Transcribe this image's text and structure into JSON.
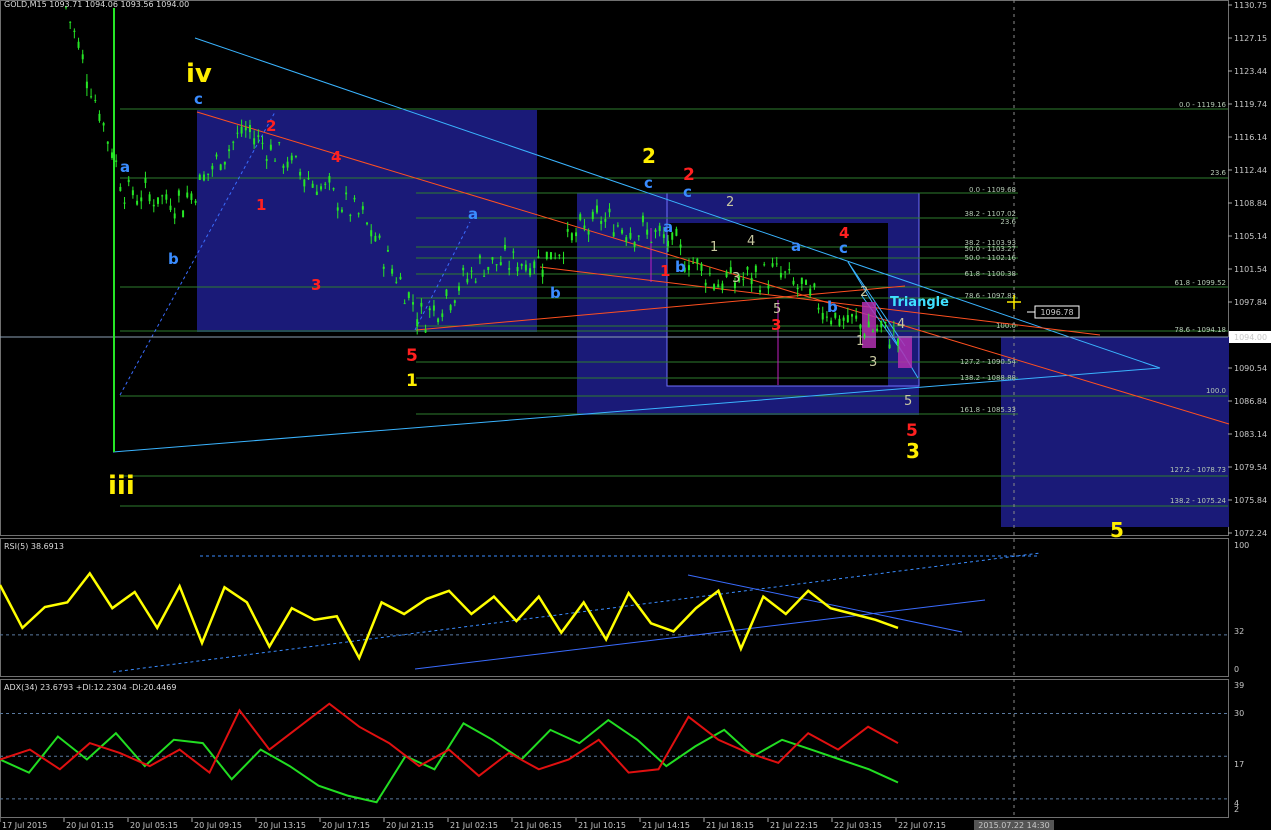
{
  "main_header": "GOLD,M15  1093.71 1094.06 1093.56 1094.00",
  "rsi_header": "RSI(5) 38.6913",
  "adx_header": "ADX(34) 23.6793  +DI:12.2304  -DI:20.4469",
  "price_ticks": [
    "1130.75",
    "1127.15",
    "1123.44",
    "1119.74",
    "1116.14",
    "1112.44",
    "1108.84",
    "1105.14",
    "1101.54",
    "1097.84",
    "1094.00",
    "1090.54",
    "1086.84",
    "1083.14",
    "1079.54",
    "1075.84",
    "1072.24"
  ],
  "current_price": "1094.00",
  "cursor_price": "1096.78",
  "rsi_ticks": [
    "100",
    "32",
    "0"
  ],
  "adx_ticks": [
    "39",
    "30",
    "17",
    "4",
    "2"
  ],
  "time_ticks": [
    "17 Jul 2015",
    "20 Jul 01:15",
    "20 Jul 05:15",
    "20 Jul 09:15",
    "20 Jul 13:15",
    "20 Jul 17:15",
    "20 Jul 21:15",
    "21 Jul 02:15",
    "21 Jul 06:15",
    "21 Jul 10:15",
    "21 Jul 14:15",
    "21 Jul 18:15",
    "21 Jul 22:15",
    "22 Jul 03:15",
    "22 Jul 07:15"
  ],
  "time_cursor": "2015.07.22 14:30",
  "fib_levels_a": [
    "0.0 - 1119.16",
    "23.6",
    "61.8 - 1099.52",
    "78.6 - 1094.18",
    "100.0",
    "127.2 - 1078.73",
    "138.2 - 1075.24"
  ],
  "fib_levels_b": [
    "0.0 - 1109.68",
    "38.2 - 1107.02",
    "23.6",
    "38.2 - 1103.93",
    "50.0 - 1103.27",
    "50.0 - 1102.16",
    "61.8 - 1100.38",
    "78.6 - 1097.83",
    "100.0",
    "127.2 - 1090.54",
    "138.2 - 1088.88",
    "161.8 - 1085.33"
  ],
  "wave_labels": {
    "iv": "iv",
    "iii": "iii",
    "triangle": "Triangle",
    "a": "a",
    "b": "b",
    "c": "c",
    "n1": "1",
    "n2": "2",
    "n3": "3",
    "n4": "4",
    "n5": "5"
  },
  "colors": {
    "background": "#000000",
    "candle": "#26e626",
    "rsi": "#ffff00",
    "plus_di": "#22dd22",
    "minus_di": "#e01010",
    "box": "#1a1a78",
    "trendline": "#3ab4ff",
    "orange": "#ff5020",
    "fib": "#2e7d2e",
    "wave_yellow": "#ffee00",
    "wave_red": "#ff2020",
    "wave_blue": "#3a8cff",
    "wave_grey": "#c8c8a0"
  },
  "chart_data": [
    {
      "type": "candlestick",
      "title": "GOLD,M15",
      "ylim": [
        1072.24,
        1130.75
      ],
      "x": [
        "17 Jul 2015",
        "20 Jul 01:15",
        "20 Jul 05:15",
        "20 Jul 09:15",
        "20 Jul 13:15",
        "20 Jul 17:15",
        "20 Jul 21:15",
        "21 Jul 02:15",
        "21 Jul 06:15",
        "21 Jul 10:15",
        "21 Jul 14:15",
        "21 Jul 18:15",
        "21 Jul 22:15",
        "22 Jul 03:15",
        "22 Jul 07:15"
      ],
      "close_approx": [
        1130.5,
        1110.0,
        1109.0,
        1117.0,
        1112.0,
        1107.0,
        1096.0,
        1102.0,
        1102.5,
        1107.0,
        1105.0,
        1100.0,
        1101.0,
        1096.0,
        1094.0
      ],
      "last_ohlc": {
        "open": 1093.71,
        "high": 1094.06,
        "low": 1093.56,
        "close": 1094.0
      }
    },
    {
      "type": "line",
      "title": "RSI(5)",
      "ylim": [
        0,
        100
      ],
      "series": [
        {
          "name": "RSI(5)",
          "values": [
            75,
            38,
            56,
            60,
            85,
            55,
            69,
            38,
            74,
            25,
            73,
            60,
            22,
            55,
            45,
            48,
            12,
            60,
            50,
            63,
            70,
            50,
            65,
            44,
            65,
            34,
            60,
            28,
            68,
            42,
            35,
            55,
            70,
            20,
            65,
            50,
            70,
            55,
            50,
            45,
            38
          ]
        }
      ]
    },
    {
      "type": "line",
      "title": "ADX(34)",
      "ylim": [
        0,
        39
      ],
      "series": [
        {
          "name": "+DI",
          "values": [
            16,
            12,
            23,
            16,
            24,
            14,
            22,
            21,
            10,
            19,
            14,
            8,
            5,
            3,
            17,
            13,
            27,
            22,
            16,
            25,
            21,
            28,
            22,
            14,
            20,
            25,
            17,
            22,
            19,
            16,
            13,
            9
          ]
        },
        {
          "name": "-DI",
          "values": [
            16,
            19,
            13,
            21,
            18,
            14,
            19,
            12,
            31,
            19,
            26,
            33,
            26,
            21,
            14,
            19,
            11,
            18,
            13,
            16,
            22,
            12,
            13,
            29,
            22,
            18,
            15,
            24,
            19,
            26,
            21
          ]
        }
      ]
    }
  ]
}
